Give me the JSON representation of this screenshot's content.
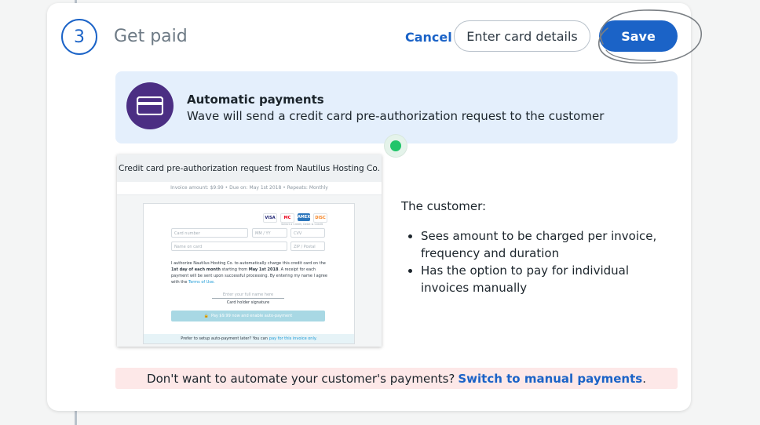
{
  "step": {
    "number": "3",
    "title": "Get paid"
  },
  "actions": {
    "cancel_label": "Cancel",
    "enter_card_label": "Enter card details",
    "save_label": "Save"
  },
  "info": {
    "icon": "credit-card-icon",
    "title": "Automatic payments",
    "description": "Wave will send a credit card pre-authorization request to the customer"
  },
  "preview": {
    "header": "Credit card pre-authorization request from Nautilus Hosting Co.",
    "subheader": "Invoice amount: $9.99 • Due on: May 1st 2018 • Repeats: Monthly",
    "brands": [
      "VISA",
      "MC",
      "AMEX",
      "DISC"
    ],
    "brands_note": "Select a Credit, Debit & Credit",
    "fields": {
      "card_number": "Card number",
      "expiry": "MM / YY",
      "cvv": "CVV",
      "name": "Name on card",
      "zip": "ZIP / Postal"
    },
    "auth_text_1": "I authorize Nautilus Hosting Co. to automatically charge this credit card on the",
    "auth_bold_1": "1st day of each month",
    "auth_text_2": "starting from",
    "auth_bold_2": "May 1st 2018",
    "auth_text_3": ". A receipt for each payment will be sent upon successful processing. By entering my name I agree with the",
    "auth_link": "Terms of Use.",
    "signature_placeholder": "Enter your full name here",
    "signature_label": "Card holder signature",
    "pay_button": "Pay $9.99 now and enable auto-payment",
    "footer_text": "Prefer to setup auto-payment later? You can",
    "footer_link": "pay for this invoice only."
  },
  "customer": {
    "title": "The customer:",
    "points": [
      "Sees amount to be charged per invoice, frequency and duration",
      "Has the option to pay for individual invoices manually"
    ]
  },
  "manual": {
    "prompt": "Don't want to automate your customer's payments?",
    "link": "Switch to manual payments",
    "suffix": "."
  },
  "colors": {
    "accent": "#1b63c7",
    "info_bg": "#e4effc",
    "icon_bg": "#4b2e83",
    "status_dot": "#21c56a",
    "manual_bg": "#fde8e8"
  }
}
